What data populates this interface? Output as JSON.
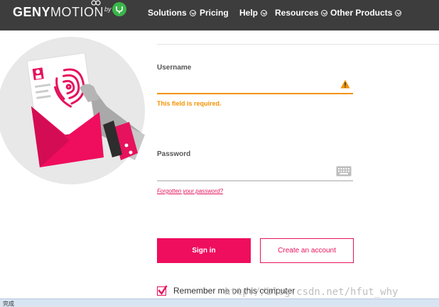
{
  "brand": {
    "logo_bold": "GENY",
    "logo_light": "MOTION",
    "by_text": "by"
  },
  "nav": {
    "items": [
      {
        "label": "Solutions",
        "has_dropdown": true
      },
      {
        "label": "Pricing",
        "has_dropdown": false
      },
      {
        "label": "Help",
        "has_dropdown": true
      },
      {
        "label": "Resources",
        "has_dropdown": true
      },
      {
        "label": "Other Products",
        "has_dropdown": true
      }
    ]
  },
  "form": {
    "username_label": "Username",
    "username_value": "",
    "username_error": "This field is required.",
    "password_label": "Password",
    "password_value": "",
    "forgot_link": "Forgotten your password?",
    "signin_button": "Sign in",
    "create_account_button": "Create an account",
    "remember_label": "Remember me on this computer",
    "remember_checked": true
  },
  "watermark": "http://blog.csdn.net/hfut_why",
  "statusbar": {
    "text": "完成"
  },
  "colors": {
    "accent": "#ef0d5e",
    "warning": "#f39200",
    "topbar": "#3d3d3d",
    "brand_green": "#3bb54a"
  },
  "icons": [
    "genymotion-logo-icon",
    "genymobile-badge-icon",
    "warning-icon",
    "keyboard-icon",
    "checkmark-icon",
    "fingerprint-envelope-illustration"
  ]
}
